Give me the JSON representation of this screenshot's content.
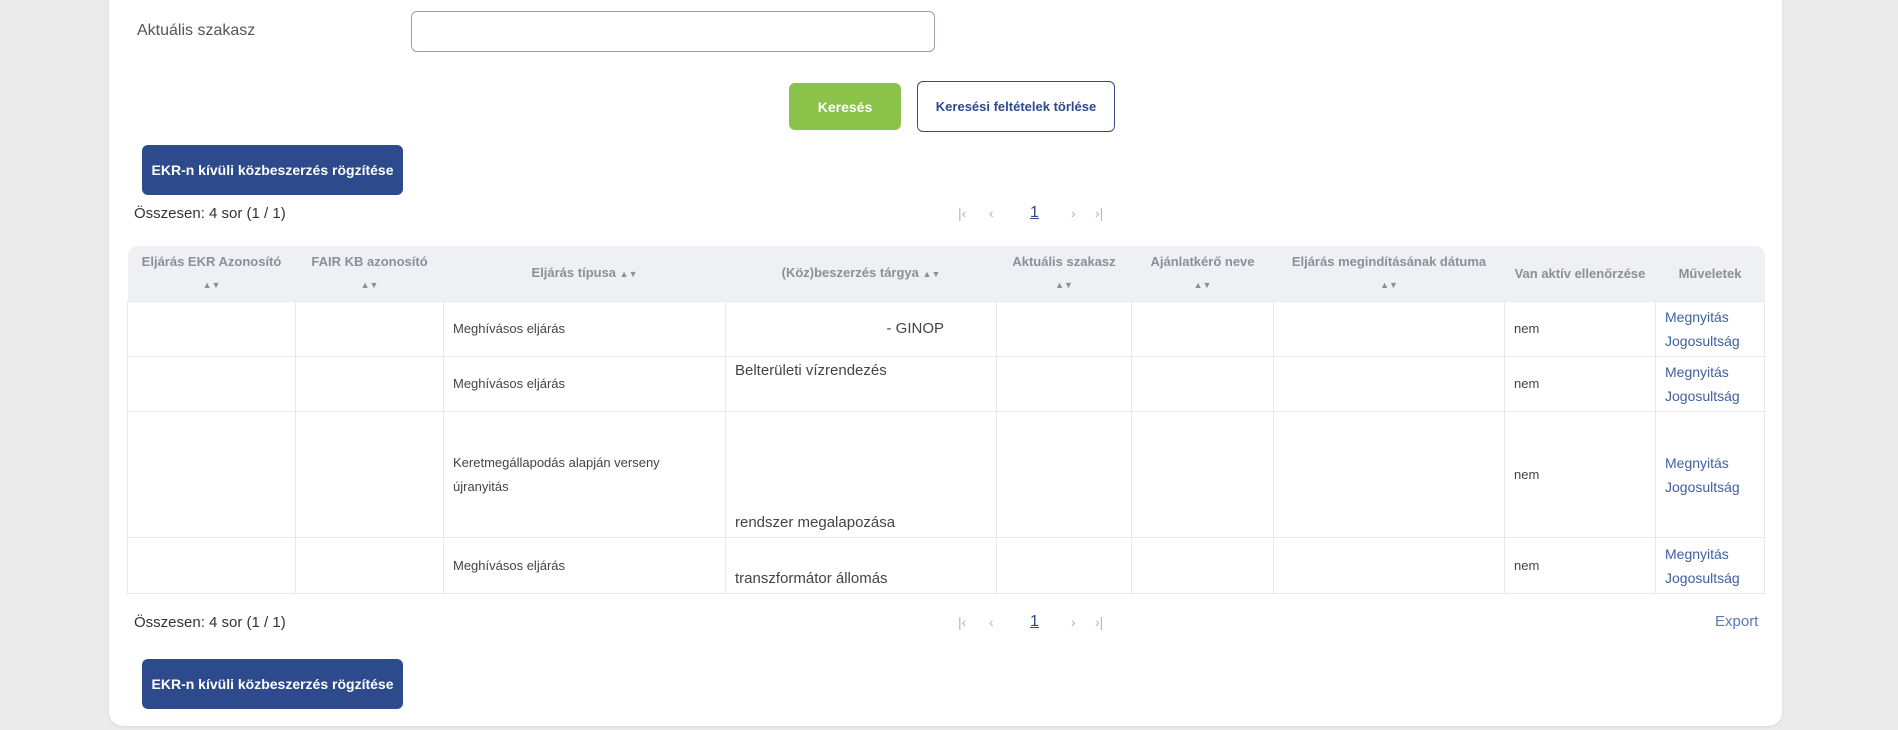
{
  "filter": {
    "stage_label": "Aktuális szakasz",
    "stage_value": "",
    "search_label": "Keresés",
    "clear_label": "Keresési feltételek törlése"
  },
  "actions": {
    "add_label": "EKR-n kívüli közbeszerzés rögzítése",
    "export_label": "Export"
  },
  "summary": {
    "text": "Összesen: 4 sor (1 / 1)"
  },
  "pagination": {
    "first": "|‹",
    "prev": "‹",
    "page": "1",
    "next": "›",
    "last": "›|"
  },
  "table": {
    "headers": [
      "Eljárás EKR Azonosító",
      "FAIR KB azonosító",
      "Eljárás típusa",
      "(Köz)beszerzés tárgya",
      "Aktuális szakasz",
      "Ajánlatkérő neve",
      "Eljárás megindításának dátuma",
      "Van aktív ellenőrzése",
      "Műveletek"
    ],
    "rows": [
      {
        "ekr_id": "",
        "fair_id": "",
        "type": "Meghívásos eljárás",
        "subject": "- GINOP",
        "stage": "",
        "requester": "",
        "start_date": "",
        "active_check": "nem",
        "open": "Megnyitás",
        "rights": "Jogosultság"
      },
      {
        "ekr_id": "",
        "fair_id": "",
        "type": "Meghívásos eljárás",
        "subject": "Belterületi vízrendezés",
        "stage": "",
        "requester": "",
        "start_date": "",
        "active_check": "nem",
        "open": "Megnyitás",
        "rights": "Jogosultság"
      },
      {
        "ekr_id": "",
        "fair_id": "",
        "type": "Keretmegállapodás alapján verseny újranyitás",
        "subject": "rendszer megalapozása",
        "stage": "",
        "requester": "",
        "start_date": "",
        "active_check": "nem",
        "open": "Megnyitás",
        "rights": "Jogosultság"
      },
      {
        "ekr_id": "",
        "fair_id": "",
        "type": "Meghívásos eljárás",
        "subject": "transzformátor állomás",
        "stage": "",
        "requester": "",
        "start_date": "",
        "active_check": "nem",
        "open": "Megnyitás",
        "rights": "Jogosultság"
      }
    ]
  }
}
